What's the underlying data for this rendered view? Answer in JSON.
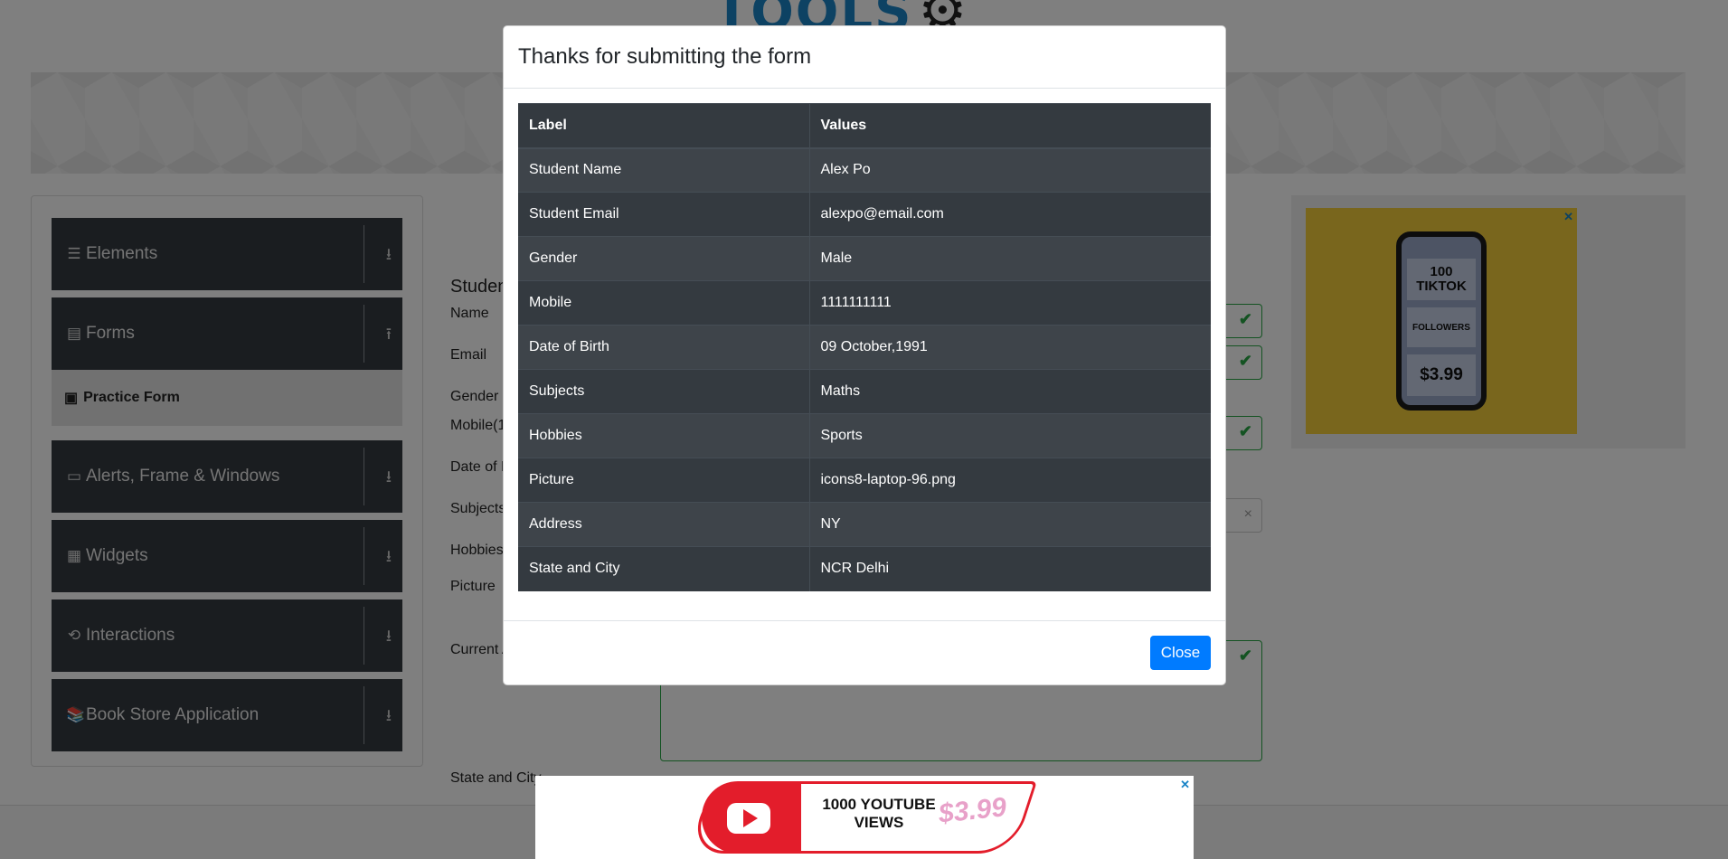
{
  "logo": {
    "text": "TOOLS",
    "gear": "⚙"
  },
  "sidebar": {
    "groups": [
      {
        "label": "Elements",
        "icon": "☰",
        "arrow": "⭳"
      },
      {
        "label": "Forms",
        "icon": "▤",
        "arrow": "⭱"
      },
      {
        "label": "Alerts, Frame & Windows",
        "icon": "▭",
        "arrow": "⭳"
      },
      {
        "label": "Widgets",
        "icon": "▦",
        "arrow": "⭳"
      },
      {
        "label": "Interactions",
        "icon": "⟲",
        "arrow": "⭳"
      },
      {
        "label": "Book Store Application",
        "icon": "📚",
        "arrow": "⭳"
      }
    ],
    "active_item": {
      "label": "Practice Form",
      "icon": "▣"
    }
  },
  "form": {
    "title": "Studen",
    "labels": {
      "name": "Name",
      "email": "Email",
      "gender": "Gender",
      "mobile": "Mobile(1",
      "dob": "Date of B",
      "subjects": "Subjects",
      "hobbies": "Hobbies",
      "picture": "Picture",
      "address": "Current A",
      "state": "State and City"
    },
    "check": "✔",
    "clear": "×"
  },
  "side_ad": {
    "line1": "100 TIKTOK",
    "line2": "FOLLOWERS",
    "price": "$3.99",
    "close": "✕"
  },
  "bottom_ad": {
    "text": "1000 YOUTUBE VIEWS",
    "price": "$3.99",
    "close": "✕"
  },
  "modal": {
    "title": "Thanks for submitting the form",
    "headers": {
      "label": "Label",
      "values": "Values"
    },
    "rows": [
      {
        "label": "Student Name",
        "value": "Alex Po"
      },
      {
        "label": "Student Email",
        "value": "alexpo@email.com"
      },
      {
        "label": "Gender",
        "value": "Male"
      },
      {
        "label": "Mobile",
        "value": "1111111111"
      },
      {
        "label": "Date of Birth",
        "value": "09 October,1991"
      },
      {
        "label": "Subjects",
        "value": "Maths"
      },
      {
        "label": "Hobbies",
        "value": "Sports"
      },
      {
        "label": "Picture",
        "value": "icons8-laptop-96.png"
      },
      {
        "label": "Address",
        "value": "NY"
      },
      {
        "label": "State and City",
        "value": "NCR Delhi"
      }
    ],
    "close_label": "Close"
  },
  "colors": {
    "primary": "#007bff",
    "dark": "#343a40",
    "success": "#28a745",
    "logo_blue": "#1a84c7",
    "ad_yellow": "#f2cd3b",
    "youtube_red": "#e31d2b"
  }
}
